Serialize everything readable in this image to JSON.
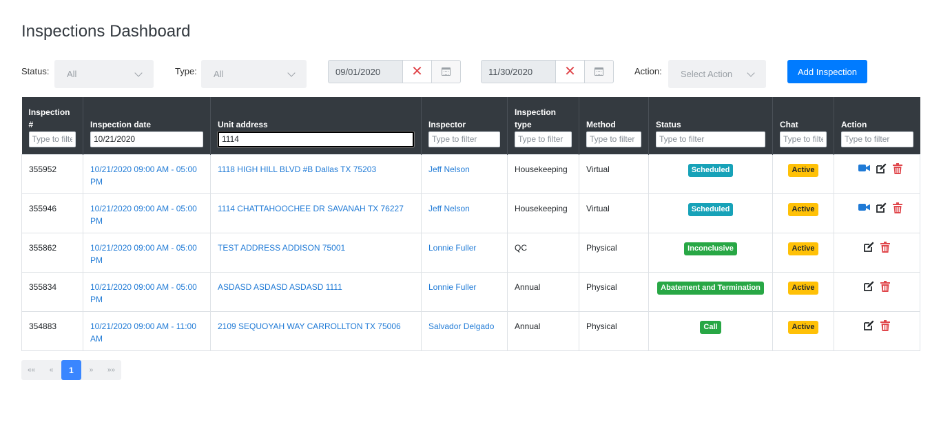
{
  "page": {
    "title": "Inspections Dashboard"
  },
  "filters": {
    "status_label": "Status:",
    "status_value": "All",
    "type_label": "Type:",
    "type_value": "All",
    "date_from": "09/01/2020",
    "date_to": "11/30/2020",
    "action_label": "Action:",
    "action_placeholder": "Select Action",
    "add_label": "Add Inspection"
  },
  "columns": [
    {
      "label": "Inspection #",
      "filter_value": "",
      "filter_placeholder": "Type to filter"
    },
    {
      "label": "Inspection date",
      "filter_value": "10/21/2020",
      "filter_placeholder": "Type to filter"
    },
    {
      "label": "Unit address",
      "filter_value": "1114",
      "filter_placeholder": "Type to filter"
    },
    {
      "label": "Inspector",
      "filter_value": "",
      "filter_placeholder": "Type to filter"
    },
    {
      "label": "Inspection type",
      "filter_value": "",
      "filter_placeholder": "Type to filter"
    },
    {
      "label": "Method",
      "filter_value": "",
      "filter_placeholder": "Type to filter"
    },
    {
      "label": "Status",
      "filter_value": "",
      "filter_placeholder": "Type to filter"
    },
    {
      "label": "Chat",
      "filter_value": "",
      "filter_placeholder": "Type to filter"
    },
    {
      "label": "Action",
      "filter_value": "",
      "filter_placeholder": "Type to filter"
    }
  ],
  "rows": [
    {
      "id": "355952",
      "date": "10/21/2020 09:00 AM - 05:00 PM",
      "address": "1118 HIGH HILL BLVD #B Dallas TX 75203",
      "inspector": "Jeff Nelson",
      "type": "Housekeeping",
      "method": "Virtual",
      "status": "Scheduled",
      "status_color": "#17a2b8",
      "chat": "Active",
      "video": true
    },
    {
      "id": "355946",
      "date": "10/21/2020 09:00 AM - 05:00 PM",
      "address": "1114 CHATTAHOOCHEE DR SAVANAH TX 76227",
      "inspector": "Jeff Nelson",
      "type": "Housekeeping",
      "method": "Virtual",
      "status": "Scheduled",
      "status_color": "#17a2b8",
      "chat": "Active",
      "video": true
    },
    {
      "id": "355862",
      "date": "10/21/2020 09:00 AM - 05:00 PM",
      "address": "TEST ADDRESS ADDISON 75001",
      "inspector": "Lonnie Fuller",
      "type": "QC",
      "method": "Physical",
      "status": "Inconclusive",
      "status_color": "#28a745",
      "chat": "Active",
      "video": false
    },
    {
      "id": "355834",
      "date": "10/21/2020 09:00 AM - 05:00 PM",
      "address": "ASDASD ASDASD ASDASD 1111",
      "inspector": "Lonnie Fuller",
      "type": "Annual",
      "method": "Physical",
      "status": "Abatement and Termination",
      "status_color": "#28a745",
      "chat": "Active",
      "video": false
    },
    {
      "id": "354883",
      "date": "10/21/2020 09:00 AM - 11:00 AM",
      "address": "2109 SEQUOYAH WAY CARROLLTON TX 75006",
      "inspector": "Salvador Delgado",
      "type": "Annual",
      "method": "Physical",
      "status": "Call",
      "status_color": "#28a745",
      "chat": "Active",
      "video": false
    }
  ],
  "pagination": {
    "first": "««",
    "prev": "«",
    "current": "1",
    "next": "»",
    "last": "»»"
  },
  "colors": {
    "primary": "#007bff",
    "header_bg": "#343a40",
    "link": "#1f7ad6",
    "danger": "#e0474c",
    "warning": "#ffc107"
  },
  "icons": {
    "video": "video-camera-icon",
    "edit": "edit-icon",
    "delete": "trash-icon",
    "calendar": "calendar-icon",
    "clear": "close-icon"
  }
}
